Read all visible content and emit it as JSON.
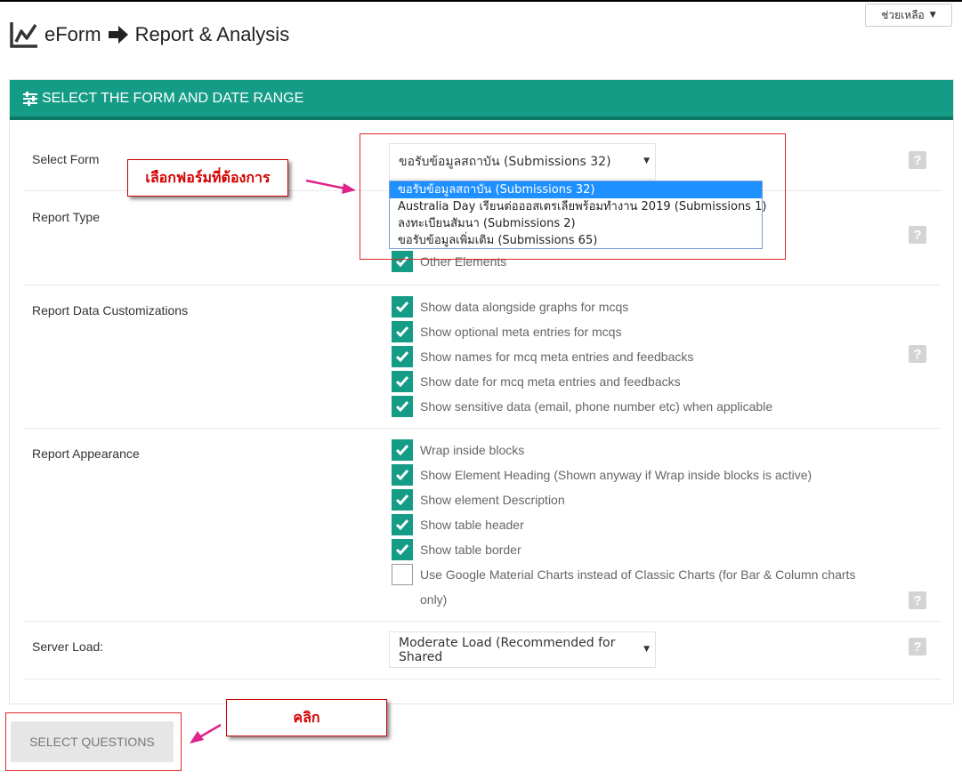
{
  "header": {
    "app_name": "eForm",
    "page_name": "Report & Analysis",
    "help_label": "ช่วยเหลือ"
  },
  "panel": {
    "title": "SELECT THE FORM AND DATE RANGE"
  },
  "select_form": {
    "label": "Select Form",
    "selected": "ขอรับข้อมูลสถาบัน (Submissions 32)",
    "options": [
      "ขอรับข้อมูลสถาบัน (Submissions 32)",
      "Australia Day เรียนต่อออสเตรเลียพร้อมทำงาน 2019 (Submissions 1)",
      "ลงทะเบียนสัมนา (Submissions 2)",
      "ขอรับข้อมูลเพิ่มเติม (Submissions 65)"
    ]
  },
  "report_type": {
    "label": "Report Type",
    "items": [
      {
        "label": "Other Elements",
        "checked": true
      }
    ]
  },
  "data_customizations": {
    "label": "Report Data Customizations",
    "items": [
      {
        "label": "Show data alongside graphs for mcqs",
        "checked": true
      },
      {
        "label": "Show optional meta entries for mcqs",
        "checked": true
      },
      {
        "label": "Show names for mcq meta entries and feedbacks",
        "checked": true
      },
      {
        "label": "Show date for mcq meta entries and feedbacks",
        "checked": true
      },
      {
        "label": "Show sensitive data (email, phone number etc) when applicable",
        "checked": true
      }
    ]
  },
  "appearance": {
    "label": "Report Appearance",
    "items": [
      {
        "label": "Wrap inside blocks",
        "checked": true
      },
      {
        "label": "Show Element Heading (Shown anyway if Wrap inside blocks is active)",
        "checked": true
      },
      {
        "label": "Show element Description",
        "checked": true
      },
      {
        "label": "Show table header",
        "checked": true
      },
      {
        "label": "Show table border",
        "checked": true
      },
      {
        "label": "Use Google Material Charts instead of Classic Charts (for Bar & Column charts only)",
        "checked": false
      }
    ]
  },
  "server_load": {
    "label": "Server Load:",
    "selected": "Moderate Load (Recommended for Shared"
  },
  "help_mark": "?",
  "submit_label": "SELECT QUESTIONS",
  "annotations": {
    "select_callout": "เลือกฟอร์มที่ต้องการ",
    "click_callout": "คลิก"
  },
  "colors": {
    "accent": "#149c86",
    "accent_dark": "#0d7866",
    "highlight": "#1e90ff",
    "annotation_red": "#e0262b",
    "arrow_pink": "#e0238a"
  }
}
